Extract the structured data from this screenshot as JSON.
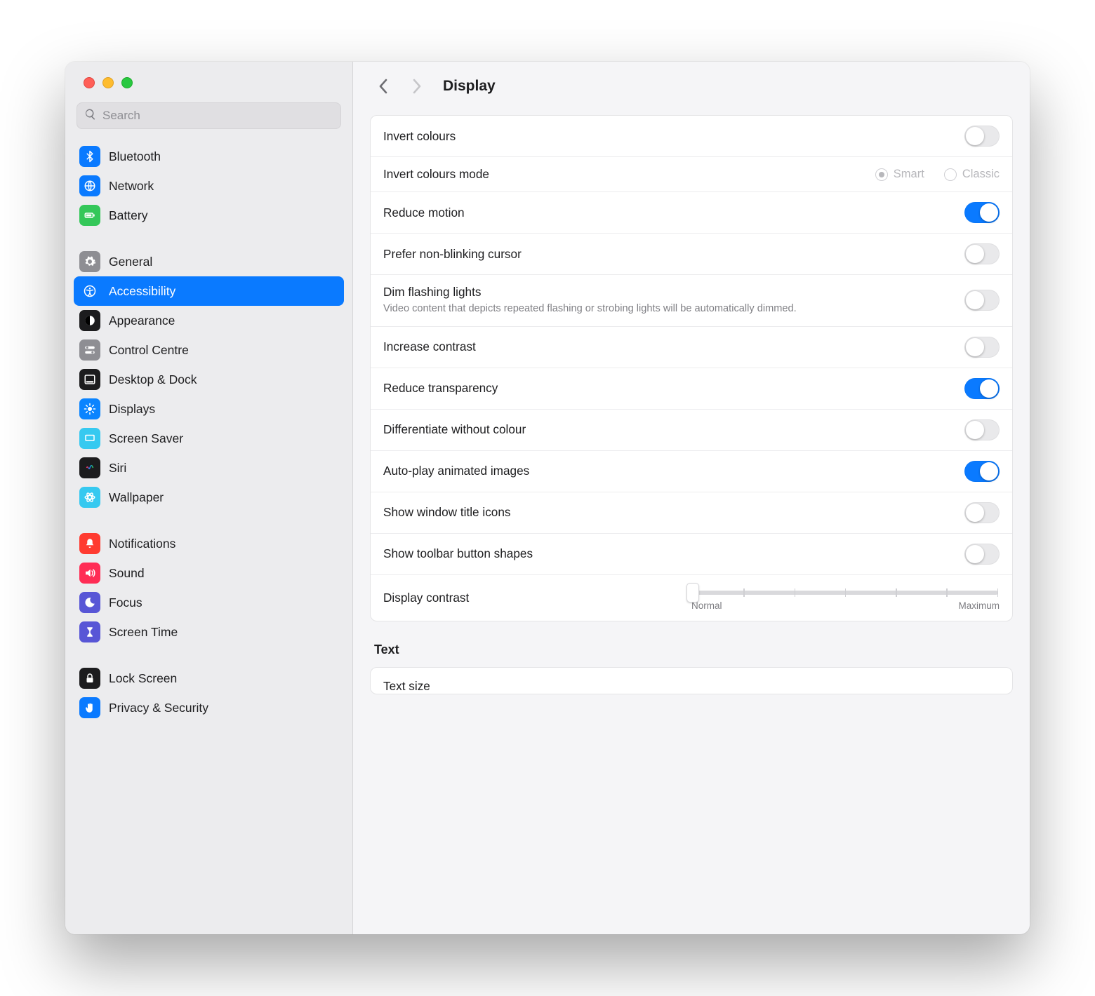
{
  "search": {
    "placeholder": "Search",
    "value": ""
  },
  "header": {
    "title": "Display"
  },
  "sidebar": {
    "groups": [
      {
        "items": [
          {
            "id": "bluetooth",
            "label": "Bluetooth",
            "color": "#0a7aff",
            "icon": "bluetooth"
          },
          {
            "id": "network",
            "label": "Network",
            "color": "#0a7aff",
            "icon": "globe"
          },
          {
            "id": "battery",
            "label": "Battery",
            "color": "#34c759",
            "icon": "battery"
          }
        ]
      },
      {
        "items": [
          {
            "id": "general",
            "label": "General",
            "color": "#8e8e93",
            "icon": "gear"
          },
          {
            "id": "accessibility",
            "label": "Accessibility",
            "color": "#0a7aff",
            "icon": "accessibility",
            "selected": true
          },
          {
            "id": "appearance",
            "label": "Appearance",
            "color": "#1c1c1e",
            "icon": "appearance"
          },
          {
            "id": "controlcentre",
            "label": "Control Centre",
            "color": "#8e8e93",
            "icon": "switches"
          },
          {
            "id": "desktopdock",
            "label": "Desktop & Dock",
            "color": "#1c1c1e",
            "icon": "dock"
          },
          {
            "id": "displays",
            "label": "Displays",
            "color": "#0a84ff",
            "icon": "sun"
          },
          {
            "id": "screensaver",
            "label": "Screen Saver",
            "color": "#36c9f0",
            "icon": "screensaver"
          },
          {
            "id": "siri",
            "label": "Siri",
            "color": "siri",
            "icon": "siri"
          },
          {
            "id": "wallpaper",
            "label": "Wallpaper",
            "color": "#36c9f0",
            "icon": "wallpaper"
          }
        ]
      },
      {
        "items": [
          {
            "id": "notifications",
            "label": "Notifications",
            "color": "#ff3b30",
            "icon": "bell"
          },
          {
            "id": "sound",
            "label": "Sound",
            "color": "#ff2d55",
            "icon": "speaker"
          },
          {
            "id": "focus",
            "label": "Focus",
            "color": "#5856d6",
            "icon": "moon"
          },
          {
            "id": "screentime",
            "label": "Screen Time",
            "color": "#5856d6",
            "icon": "hourglass"
          }
        ]
      },
      {
        "items": [
          {
            "id": "lockscreen",
            "label": "Lock Screen",
            "color": "#1c1c1e",
            "icon": "lock"
          },
          {
            "id": "privacy",
            "label": "Privacy & Security",
            "color": "#0a7aff",
            "icon": "hand"
          }
        ]
      }
    ]
  },
  "settings": {
    "invert_colours": {
      "title": "Invert colours",
      "on": false
    },
    "invert_mode": {
      "title": "Invert colours mode",
      "options": [
        "Smart",
        "Classic"
      ],
      "selected": "Smart"
    },
    "reduce_motion": {
      "title": "Reduce motion",
      "on": true
    },
    "nonblinking_cursor": {
      "title": "Prefer non-blinking cursor",
      "on": false
    },
    "dim_flashing": {
      "title": "Dim flashing lights",
      "desc": "Video content that depicts repeated flashing or strobing lights will be automatically dimmed.",
      "on": false
    },
    "increase_contrast": {
      "title": "Increase contrast",
      "on": false
    },
    "reduce_transparency": {
      "title": "Reduce transparency",
      "on": true
    },
    "diff_without_colour": {
      "title": "Differentiate without colour",
      "on": false
    },
    "autoplay_images": {
      "title": "Auto-play animated images",
      "on": true
    },
    "window_title_icons": {
      "title": "Show window title icons",
      "on": false
    },
    "toolbar_shapes": {
      "title": "Show toolbar button shapes",
      "on": false
    },
    "display_contrast": {
      "title": "Display contrast",
      "min_label": "Normal",
      "max_label": "Maximum",
      "value": 0
    }
  },
  "sections": {
    "text_heading": "Text",
    "text_size_title": "Text size"
  }
}
